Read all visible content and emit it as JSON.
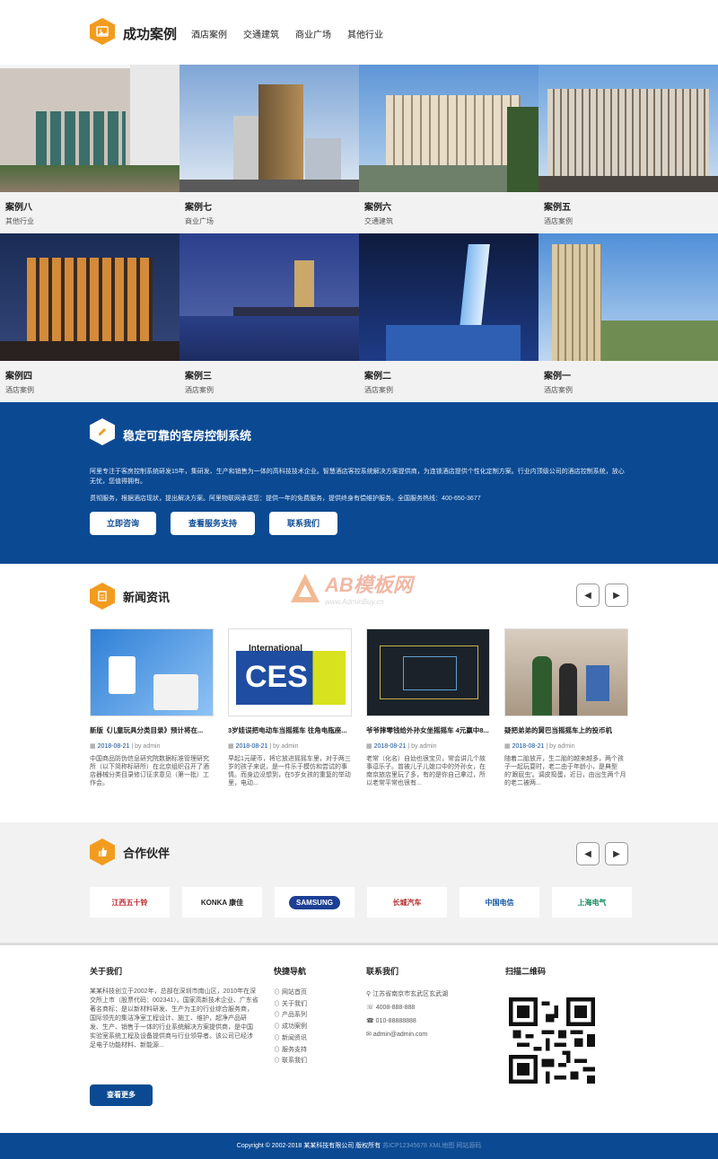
{
  "header": {
    "title": "成功案例",
    "nav": [
      "酒店案例",
      "交通建筑",
      "商业广场",
      "其他行业"
    ]
  },
  "cases": [
    {
      "name": "案例八",
      "cat": "其他行业"
    },
    {
      "name": "案例七",
      "cat": "商业广场"
    },
    {
      "name": "案例六",
      "cat": "交通建筑"
    },
    {
      "name": "案例五",
      "cat": "酒店案例"
    },
    {
      "name": "案例四",
      "cat": "酒店案例"
    },
    {
      "name": "案例三",
      "cat": "酒店案例"
    },
    {
      "name": "案例二",
      "cat": "酒店案例"
    },
    {
      "name": "案例一",
      "cat": "酒店案例"
    }
  ],
  "band": {
    "title": "稳定可靠的客房控制系统",
    "p1": "阿里专注于客房控制系统研发15年，集研发、生产和销售为一体的高科技技术企业。智慧酒店客控系统解决方案提供商，为连锁酒店提供个性化定制方案。行业内顶级公司的酒店控制系统，放心无忧，您值得拥有。",
    "p2": "贯彻服务，根据酒店现状，提出解决方案。阿里物联网承诺您：提供一年的免费服务，提供终身有偿维护服务。全国服务热线：400-650-3677",
    "buttons": [
      "立即咨询",
      "查看服务支持",
      "联系我们"
    ]
  },
  "news": {
    "title": "新闻资讯",
    "items": [
      {
        "title": "新版《儿童玩具分类目录》预计将在...",
        "date": "2018-08-21",
        "by": "by admin",
        "desc": "中国商品防伪信息研究院数据标准管理研究所（以下简称标研所）在北京组织召开了酒店器械分类目录修订征求意见（第一批）工作会。"
      },
      {
        "title": "3岁娃误把电动车当摇摇车 往角电瓶座...",
        "date": "2018-08-21",
        "by": "by admin",
        "desc": "早起1元硬币，将它放进摇摇车里，对于两三岁的孩子来说，是一件乐于模仿和尝试的事情。而身边没想到，在5岁女孩的重复的举动里，电动..."
      },
      {
        "title": "爷爷摔零钱给外孙女坐摇摇车 4元赢中8...",
        "date": "2018-08-21",
        "by": "by admin",
        "desc": "老常（化名）自幼也很宝贝，常会讲几个故事逗乐子。曾被儿子儿媳口中的外孙女，在南京旅店里玩了多，有的是你自己拿过，所以老常平常也很有..."
      },
      {
        "title": "疑把弟弟的舅巴当摇摇车上的投币机",
        "date": "2018-08-21",
        "by": "by admin",
        "desc": "随着二胎放开，生二胎的越来越多，两个孩子一起玩耍时，老二由于年龄小，是典型的'跟屁虫'。调皮捣蛋，近日，由出生两个月的老二被两..."
      }
    ]
  },
  "partners": {
    "title": "合作伙伴",
    "logos": [
      "江西五十铃",
      "KONKA 康佳",
      "SAMSUNG",
      "长城汽车",
      "中国电信",
      "上海电气"
    ]
  },
  "footer": {
    "about_title": "关于我们",
    "about_text": "某某科技创立于2002年，总部在深圳市南山区，2010年在深交所上市（股票代码：002341）。国家高新技术企业、广东省著名商标；是以新材料研发、生产为主的行业综合服务商，国际领先的集洁净室工程设计、施工、维护，超净产品研发、生产、销售于一体的行业系统解决方案提供商，是中国实验室系统工程及设备提供商与行业领导者。该公司已经涉足电子功能材料、新能源...",
    "more": "查看更多",
    "nav_title": "快捷导航",
    "nav_items": [
      "网站首页",
      "关于我们",
      "产品系列",
      "成功案例",
      "新闻资讯",
      "服务支持",
      "联系我们"
    ],
    "contact_title": "联系我们",
    "contact": [
      "江苏省南京市玄武区玄武湖",
      "4008-888-888",
      "010-88888888",
      "admin@admin.com"
    ],
    "qr_title": "扫描二维码"
  },
  "copyright": {
    "text": "Copyright © 2002-2018 某某科技有限公司 版权所有",
    "extra": "苏ICP12345678 XML地图 网站源码"
  },
  "watermark": {
    "main": "AB模板网",
    "sub": "www.AdminBuy.cn"
  },
  "colors": {
    "accent": "#f29c1f",
    "brand": "#0b4a93"
  }
}
